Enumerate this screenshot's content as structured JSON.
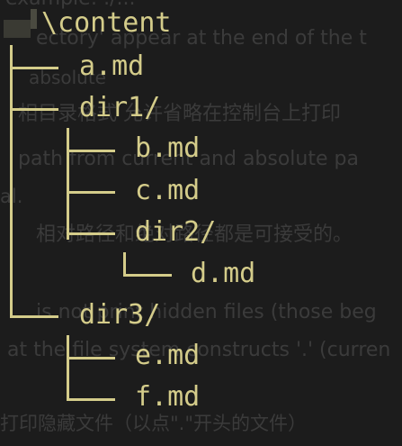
{
  "background_text": [
    "example: ./...",
    "ectory' appear at the end of the t",
    "absolute",
    "相目录格式 允许省略在控制台上打印",
    "path from current and absolute pa",
    "al.",
    "相对路径和绝对路径都是可接受的。",
    "is not print hidden files (those beg",
    "at the file system constructs '.' (curren",
    "打印隐藏文件（以点\".\"开头的文件）"
  ],
  "tree": {
    "root": "\\content",
    "items": [
      {
        "id": "a",
        "label": "a.md",
        "depth": 1
      },
      {
        "id": "dir1",
        "label": "dir1/",
        "depth": 1
      },
      {
        "id": "b",
        "label": "b.md",
        "depth": 2
      },
      {
        "id": "c",
        "label": "c.md",
        "depth": 2
      },
      {
        "id": "dir2",
        "label": "dir2/",
        "depth": 2
      },
      {
        "id": "d",
        "label": "d.md",
        "depth": 3
      },
      {
        "id": "dir3",
        "label": "dir3/",
        "depth": 1
      },
      {
        "id": "e",
        "label": "e.md",
        "depth": 2
      },
      {
        "id": "f",
        "label": "f.md",
        "depth": 2
      }
    ]
  },
  "colors": {
    "background": "#1c1c1c",
    "tree_text": "#d4cc8a",
    "ghost_text": "#3b3b3b"
  }
}
